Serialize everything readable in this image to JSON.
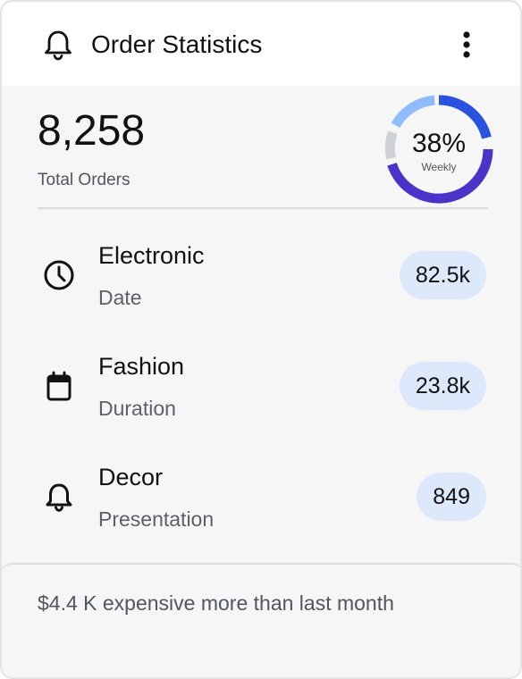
{
  "header": {
    "title": "Order Statistics",
    "icon": "bell-icon",
    "menu_icon": "more-vertical-icon"
  },
  "summary": {
    "total_value": "8,258",
    "total_label": "Total Orders",
    "donut": {
      "percent_text": "38%",
      "period_label": "Weekly",
      "percent_value": 38,
      "colors": {
        "primary": "#2a52e0",
        "secondary": "#4b33c9",
        "light": "#8ebcff",
        "gray": "#cfd1d6"
      }
    }
  },
  "categories": [
    {
      "title": "Electronic",
      "subtitle": "Date",
      "value": "82.5k",
      "icon": "clock-icon"
    },
    {
      "title": "Fashion",
      "subtitle": "Duration",
      "value": "23.8k",
      "icon": "calendar-icon"
    },
    {
      "title": "Decor",
      "subtitle": "Presentation",
      "value": "849",
      "icon": "bell-icon"
    }
  ],
  "footer": {
    "text": "$4.4 K expensive more than last month"
  },
  "colors": {
    "pill_background": "#dde8fb",
    "card_background": "#f6f6f6"
  }
}
